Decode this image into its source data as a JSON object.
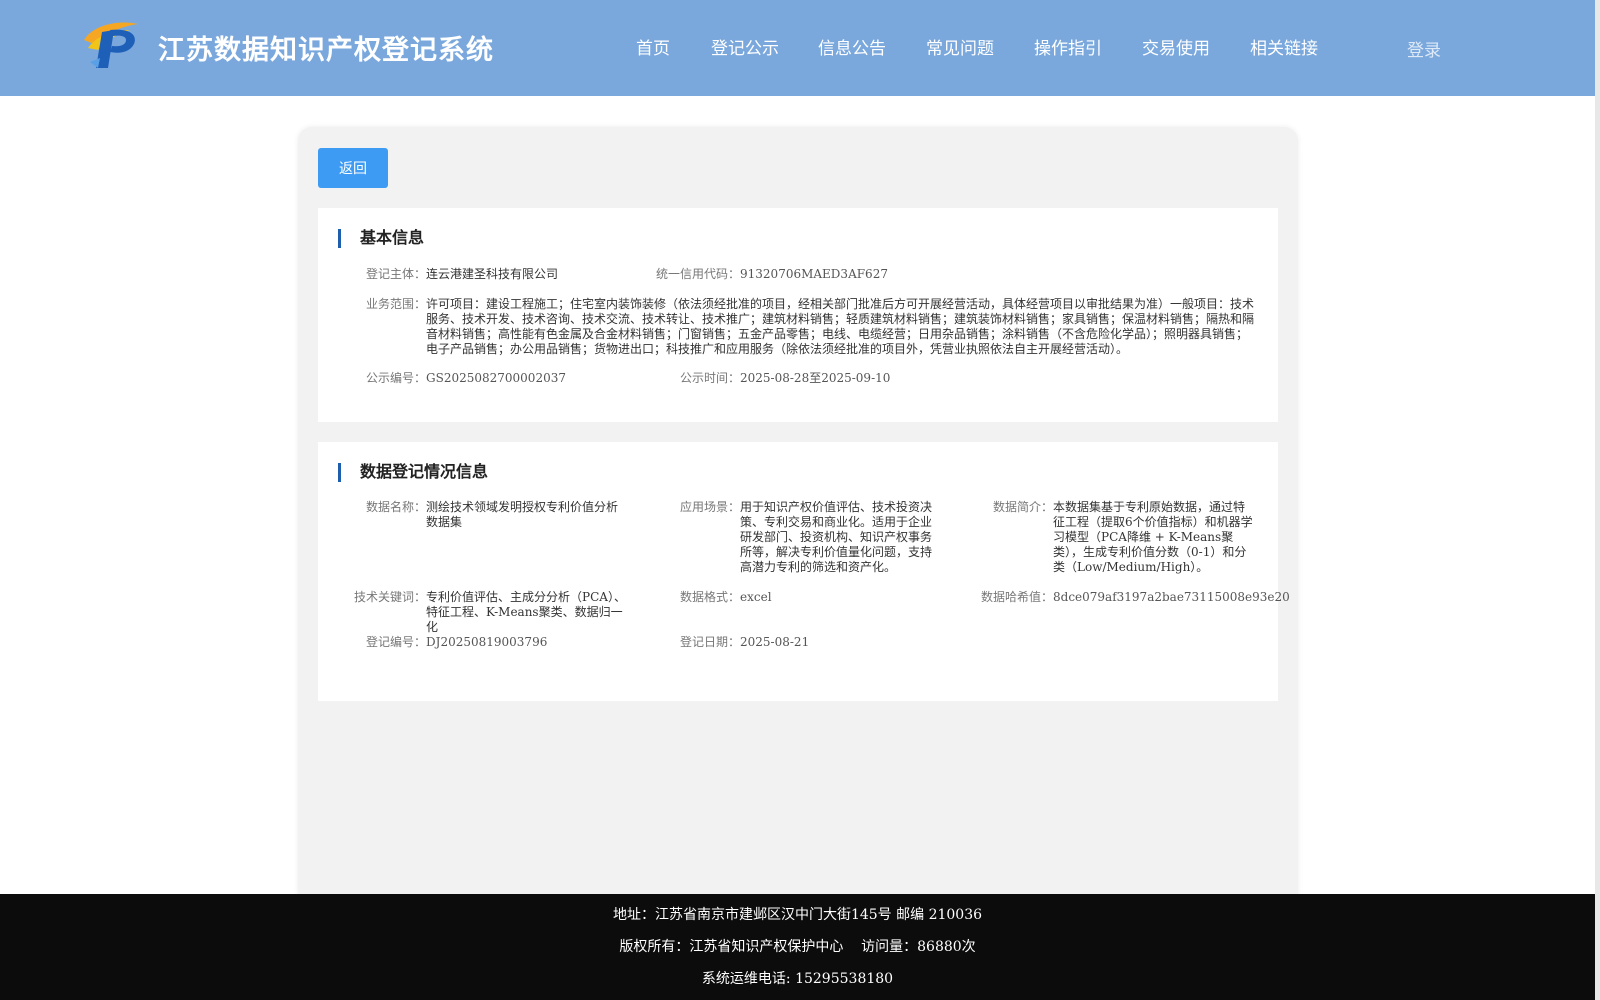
{
  "header": {
    "site_title": "江苏数据知识产权登记系统",
    "nav": [
      "首页",
      "登记公示",
      "信息公告",
      "常见问题",
      "操作指引",
      "交易使用",
      "相关链接"
    ],
    "login": "登录",
    "brand_color": "#7aa8dd"
  },
  "main": {
    "back_label": "返回",
    "basic_info": {
      "title": "基本信息",
      "subject_label": "登记主体：",
      "subject_value": "连云港建圣科技有限公司",
      "credit_code_label": "统一信用代码：",
      "credit_code_value": "91320706MAED3AF627",
      "scope_label": "业务范围：",
      "scope_value": "许可项目：建设工程施工；住宅室内装饰装修（依法须经批准的项目，经相关部门批准后方可开展经营活动，具体经营项目以审批结果为准）一般项目：技术服务、技术开发、技术咨询、技术交流、技术转让、技术推广；建筑材料销售；轻质建筑材料销售；建筑装饰材料销售；家具销售；保温材料销售；隔热和隔音材料销售；高性能有色金属及合金材料销售；门窗销售；五金产品零售；电线、电缆经营；日用杂品销售；涂料销售（不含危险化学品）；照明器具销售；电子产品销售；办公用品销售；货物进出口；科技推广和应用服务（除依法须经批准的项目外，凭营业执照依法自主开展经营活动）。",
      "pub_no_label": "公示编号：",
      "pub_no_value": "GS2025082700002037",
      "pub_time_label": "公示时间：",
      "pub_time_value": "2025-08-28至2025-09-10"
    },
    "data_info": {
      "title": "数据登记情况信息",
      "name_label": "数据名称：",
      "name_value": "测绘技术领域发明授权专利价值分析数据集",
      "scene_label": "应用场景：",
      "scene_value": "用于知识产权价值评估、技术投资决策、专利交易和商业化。适用于企业研发部门、投资机构、知识产权事务所等，解决专利价值量化问题，支持高潜力专利的筛选和资产化。",
      "intro_label": "数据简介：",
      "intro_value": "本数据集基于专利原始数据，通过特征工程（提取6个价值指标）和机器学习模型（PCA降维 + K-Means聚类），生成专利价值分数（0-1）和分类（Low/Medium/High）。",
      "keywords_label": "技术关键词：",
      "keywords_value": "专利价值评估、主成分分析（PCA）、特征工程、K-Means聚类、数据归一化",
      "format_label": "数据格式：",
      "format_value": "excel",
      "hash_label": "数据哈希值：",
      "hash_value": "8dce079af3197a2bae73115008e93e20",
      "reg_no_label": "登记编号：",
      "reg_no_value": "DJ20250819003796",
      "reg_date_label": "登记日期：",
      "reg_date_value": "2025-08-21"
    }
  },
  "footer": {
    "address": "地址：江苏省南京市建邺区汉中门大街145号 邮编 210036",
    "copyright": "版权所有：江苏省知识产权保护中心    访问量：86880次",
    "phone": "系统运维电话: 15295538180"
  }
}
